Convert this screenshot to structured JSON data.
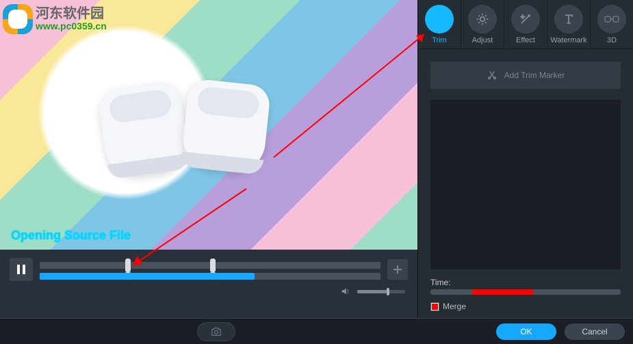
{
  "watermark": {
    "cn": "河东软件园",
    "url": "www.pc0359.cn"
  },
  "preview": {
    "status_text": "Opening Source File"
  },
  "tabs": {
    "trim": "Trim",
    "adjust": "Adjust",
    "effect": "Effect",
    "watermark": "Watermark",
    "threeD": "3D"
  },
  "panel": {
    "add_marker_label": "Add Trim Marker",
    "time_label": "Time:",
    "time_sel_start_pct": 22,
    "time_sel_end_pct": 54,
    "merge_label": "Merge",
    "merge_checked": true
  },
  "player": {
    "trim_handle1_pct": 25,
    "trim_handle2_pct": 50,
    "seek_fill_pct": 63,
    "volume_pct": 62
  },
  "footer": {
    "ok_label": "OK",
    "cancel_label": "Cancel"
  }
}
